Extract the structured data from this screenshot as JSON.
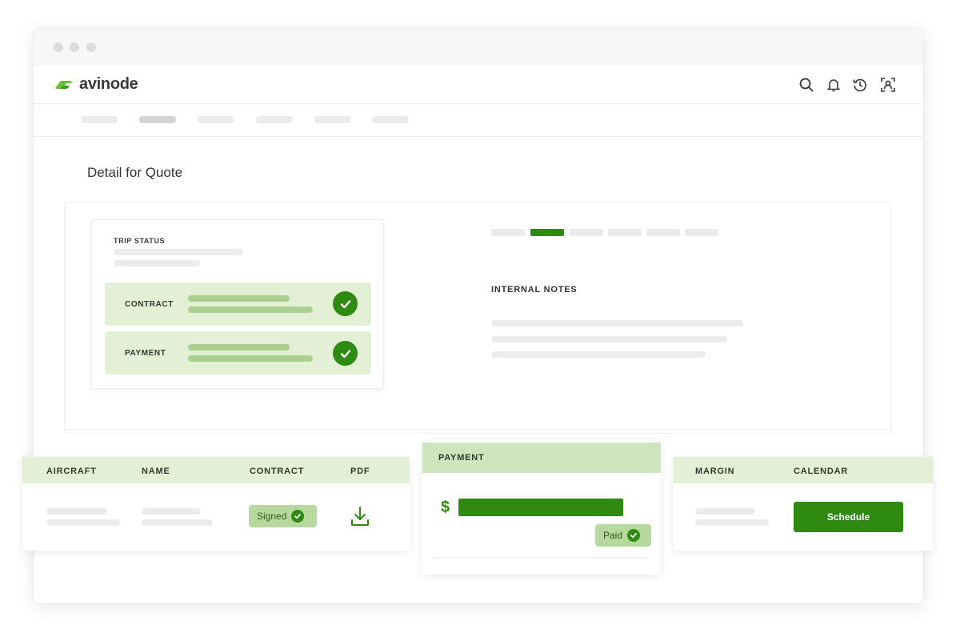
{
  "app": {
    "logo_text": "avinode",
    "brand_color": "#2f8a12",
    "light_green": "#e3f0d6"
  },
  "header": {
    "icons": [
      "search-icon",
      "bell-icon",
      "history-icon",
      "profile-scan-icon"
    ]
  },
  "nav": {
    "item_count": 6,
    "active_index": 1
  },
  "page": {
    "title": "Detail for Quote"
  },
  "trip_status": {
    "label": "TRIP STATUS",
    "rows": [
      {
        "label": "CONTRACT",
        "done": true
      },
      {
        "label": "PAYMENT",
        "done": true
      }
    ]
  },
  "steps": {
    "count": 6,
    "active_index": 1
  },
  "notes": {
    "title": "INTERNAL NOTES"
  },
  "aircraft_table": {
    "columns": [
      "AIRCRAFT",
      "NAME",
      "CONTRACT",
      "PDF"
    ],
    "contract_status": "Signed"
  },
  "payment_card": {
    "title": "PAYMENT",
    "currency_symbol": "$",
    "status": "Paid"
  },
  "margin_card": {
    "columns": [
      "MARGIN",
      "CALENDAR"
    ],
    "schedule_label": "Schedule"
  }
}
